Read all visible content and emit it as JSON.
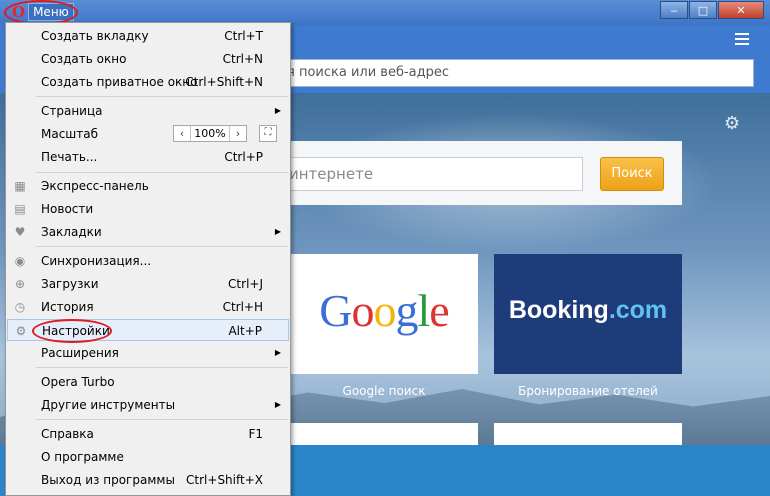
{
  "window": {
    "menu_label": "Меню",
    "logo": "O",
    "minimize": "‒",
    "maximize": "□",
    "close": "✕"
  },
  "address": {
    "placeholder": "я поиска или веб-адрес"
  },
  "search": {
    "placeholder": "интернете",
    "button": "Поиск"
  },
  "tiles": [
    {
      "logo": "Google",
      "caption": "Google поиск"
    },
    {
      "logo_main": "Booking",
      "logo_dot": ".com",
      "caption": "Бронирование отелей"
    }
  ],
  "menu": {
    "items": [
      {
        "label": "Создать вкладку",
        "shortcut": "Ctrl+T"
      },
      {
        "label": "Создать окно",
        "shortcut": "Ctrl+N"
      },
      {
        "label": "Создать приватное окно",
        "shortcut": "Ctrl+Shift+N"
      },
      {
        "label": "Страница",
        "shortcut": ""
      },
      {
        "label": "Масштаб",
        "shortcut": ""
      },
      {
        "label": "Печать...",
        "shortcut": "Ctrl+P"
      },
      {
        "label": "Экспресс-панель",
        "shortcut": ""
      },
      {
        "label": "Новости",
        "shortcut": ""
      },
      {
        "label": "Закладки",
        "shortcut": ""
      },
      {
        "label": "Синхронизация...",
        "shortcut": ""
      },
      {
        "label": "Загрузки",
        "shortcut": "Ctrl+J"
      },
      {
        "label": "История",
        "shortcut": "Ctrl+H"
      },
      {
        "label": "Настройки",
        "shortcut": "Alt+P"
      },
      {
        "label": "Расширения",
        "shortcut": ""
      },
      {
        "label": "Opera Turbo",
        "shortcut": ""
      },
      {
        "label": "Другие инструменты",
        "shortcut": ""
      },
      {
        "label": "Справка",
        "shortcut": "F1"
      },
      {
        "label": "О программе",
        "shortcut": ""
      },
      {
        "label": "Выход из программы",
        "shortcut": "Ctrl+Shift+X"
      }
    ],
    "zoom": {
      "decrease": "‹",
      "value": "100%",
      "increase": "›",
      "fit": "⛶"
    }
  },
  "icons": {
    "submenu": "▶",
    "speed_dial": "grid-icon",
    "news": "news-icon",
    "bookmarks": "heart-icon",
    "sync": "sync-icon",
    "downloads": "download-icon",
    "history": "clock-icon",
    "settings": "gear-icon"
  },
  "colors": {
    "highlight_circle": "#e01b1b",
    "search_button": "#eda117",
    "booking_bg": "#1f3c7a"
  }
}
